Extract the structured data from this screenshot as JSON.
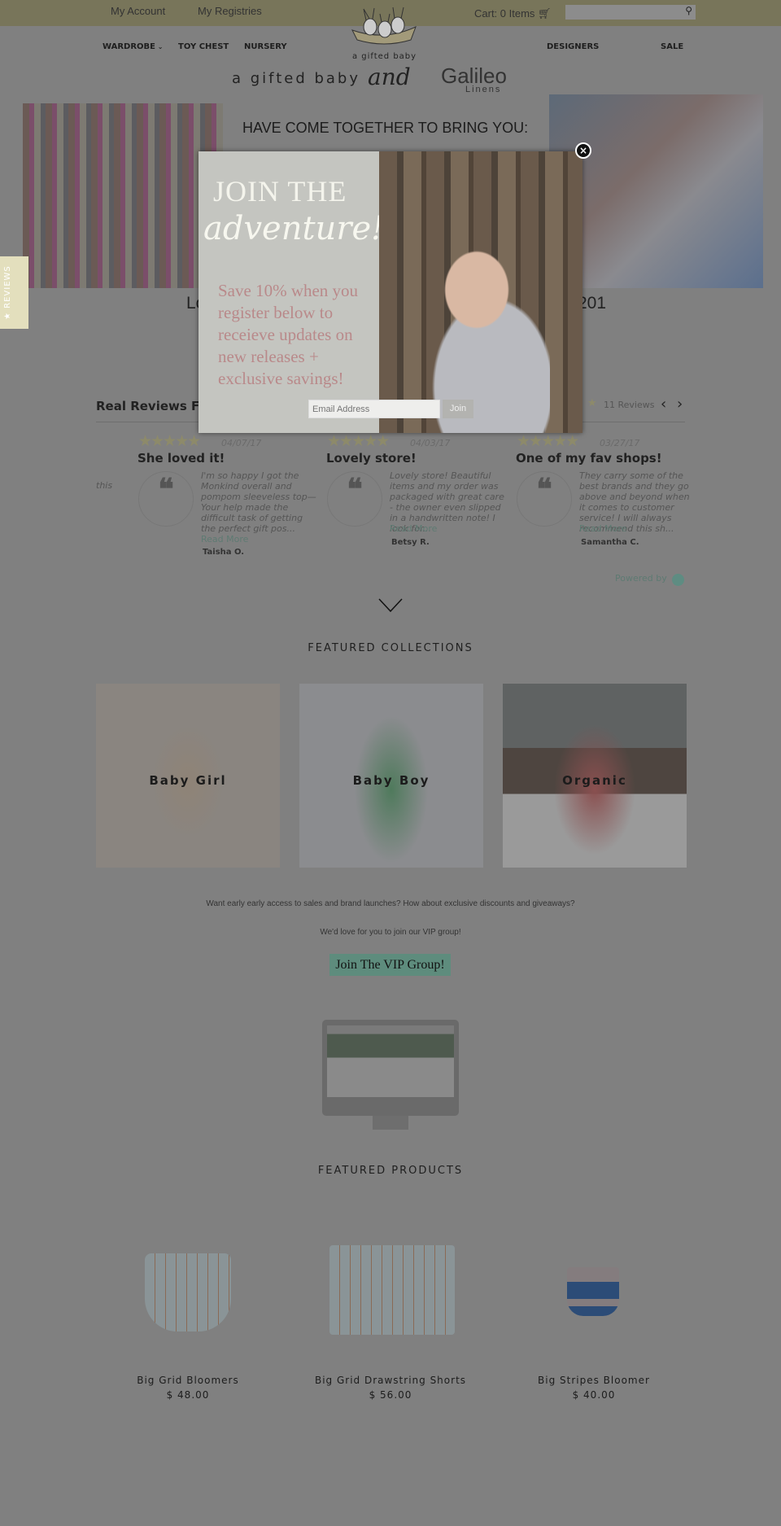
{
  "header": {
    "my_account": "My Account",
    "my_registries": "My Registries",
    "cart": "Cart: 0 Items",
    "search_placeholder": "",
    "logo_text": "a gifted baby"
  },
  "nav": {
    "items": [
      "WARDROBE",
      "TOY CHEST",
      "NURSERY",
      "DESIGNERS",
      "SALE"
    ]
  },
  "banner": {
    "brand1": "a gifted baby",
    "and": "and",
    "brand2": "Galileo",
    "brand2_sub": "Linens",
    "tagline": "HAVE COME TOGETHER TO BRING YOU:",
    "partial_left": "Lo",
    "partial_right": "201"
  },
  "popup": {
    "line1": "JOIN  THE",
    "line2": "adventure!",
    "body": "Save 10% when you register below to receieve updates on new releases + exclusive savings!",
    "email_placeholder": "Email Address",
    "join_label": "Join",
    "close": "×"
  },
  "reviews": {
    "title": "Real Reviews Fro",
    "count": "11 Reviews",
    "partial": "this",
    "powered_by": "Powered by",
    "tab_label": "★ REVIEWS",
    "items": [
      {
        "date": "04/07/17",
        "title": "She loved it!",
        "text": "I'm so happy I got the Monkind overall and pompom sleeveless top—Your help made the difficult task of getting the perfect gift pos...",
        "read_more": "Read More",
        "author": "Taisha O.",
        "rating": 5
      },
      {
        "date": "04/03/17",
        "title": "Lovely store!",
        "text": "Lovely store! Beautiful items and my order was packaged with great care - the owner even slipped in a handwritten note! I look for...",
        "read_more": "Read More",
        "author": "Betsy R.",
        "rating": 5
      },
      {
        "date": "03/27/17",
        "title": "One of my fav shops!",
        "text": "They carry some of the best brands and they go above and beyond when it comes to customer service! I will always recommend this sh...",
        "read_more": "Read More",
        "author": "Samantha C.",
        "rating": 5
      }
    ]
  },
  "collections": {
    "title": "FEATURED COLLECTIONS",
    "items": [
      "Baby Girl",
      "Baby Boy",
      "Organic"
    ]
  },
  "vip": {
    "line1": "Want early early access to sales and brand launches? How about exclusive discounts and giveaways?",
    "line2": "We'd love for you to join our VIP group!",
    "button": "Join The VIP Group!"
  },
  "products": {
    "title": "FEATURED PRODUCTS",
    "items": [
      {
        "name": "Big Grid Bloomers",
        "price": "$ 48.00"
      },
      {
        "name": "Big Grid Drawstring Shorts",
        "price": "$ 56.00"
      },
      {
        "name": "Big Stripes Bloomer",
        "price": "$ 40.00"
      }
    ]
  }
}
